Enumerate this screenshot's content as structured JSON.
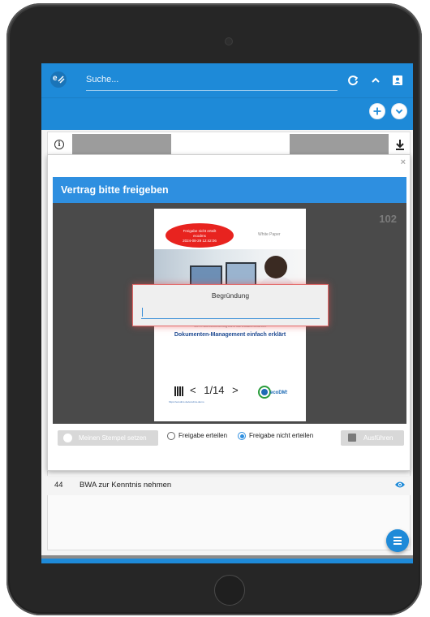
{
  "header": {
    "search_placeholder": "Suche..."
  },
  "list": {
    "row": {
      "number": "44",
      "label": "BWA zur Kenntnis nehmen"
    }
  },
  "modal": {
    "title": "Vertrag bitte freigeben",
    "page_count": "102",
    "close_symbol": "×",
    "document": {
      "stamp_lines": [
        "Freigabe nicht erteilt",
        "ecodms",
        "2024-08-29 12:42:06"
      ],
      "white_paper": "White Paper",
      "subtitle_small": "Von X ans Archivierung bis Z wie Zusammenarbeit",
      "title": "Dokumenten-Management einfach erklärt",
      "page_indicator": "1/14",
      "prev_symbol": "<",
      "next_symbol": ">",
      "qr_caption": "https://ecodms.de/ecodms-demo",
      "logo_text": "ecoDMS"
    },
    "reason_dialog": {
      "label": "Begründung",
      "value": ""
    },
    "footer": {
      "stamp_button": "Meinen Stempel setzen",
      "option_grant": "Freigabe erteilen",
      "option_deny": "Freigabe nicht erteilen",
      "selected_option": "deny",
      "execute_button": "Ausführen"
    }
  },
  "colors": {
    "primary": "#1e8ad8",
    "stamp_red": "#e8231f",
    "highlight_border": "#e36b6b"
  }
}
